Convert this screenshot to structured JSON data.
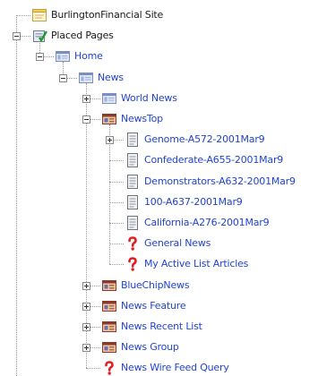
{
  "colors": {
    "link": "#2244cc",
    "dark_text": "#1a1a1a",
    "tree_line": "#9a9a9a",
    "page_folder": "#7a8fc0",
    "news_folder": "#8b3a2a",
    "question_mark": "#e02020",
    "document": "#6c7480"
  },
  "tree": [
    {
      "label": "BurlingtonFinancial Site",
      "icon": "site-icon",
      "depth": 0,
      "expander": "none",
      "style": "dark"
    },
    {
      "label": "Placed Pages",
      "icon": "placed-pages-icon",
      "depth": 0,
      "expander": "minus",
      "style": "dark"
    },
    {
      "label": "Home",
      "icon": "page-folder-icon",
      "depth": 1,
      "expander": "minus",
      "style": "link"
    },
    {
      "label": "News",
      "icon": "page-folder-icon",
      "depth": 2,
      "expander": "minus",
      "style": "link"
    },
    {
      "label": "World News",
      "icon": "page-folder-icon",
      "depth": 3,
      "expander": "plus",
      "style": "link"
    },
    {
      "label": "NewsTop",
      "icon": "news-folder-icon",
      "depth": 3,
      "expander": "minus",
      "style": "link"
    },
    {
      "label": "Genome-A572-2001Mar9",
      "icon": "document-icon",
      "depth": 4,
      "expander": "plus",
      "style": "link"
    },
    {
      "label": "Confederate-A655-2001Mar9",
      "icon": "document-icon",
      "depth": 4,
      "expander": "none",
      "style": "link"
    },
    {
      "label": "Demonstrators-A632-2001Mar9",
      "icon": "document-icon",
      "depth": 4,
      "expander": "none",
      "style": "link"
    },
    {
      "label": "100-A637-2001Mar9",
      "icon": "document-icon",
      "depth": 4,
      "expander": "none",
      "style": "link"
    },
    {
      "label": "California-A276-2001Mar9",
      "icon": "document-icon",
      "depth": 4,
      "expander": "none",
      "style": "link"
    },
    {
      "label": "General News",
      "icon": "question-icon",
      "depth": 4,
      "expander": "none",
      "style": "link"
    },
    {
      "label": "My Active List Articles",
      "icon": "question-icon",
      "depth": 4,
      "expander": "none",
      "style": "link"
    },
    {
      "label": "BlueChipNews",
      "icon": "news-folder-icon",
      "depth": 3,
      "expander": "plus",
      "style": "link"
    },
    {
      "label": "News Feature",
      "icon": "news-folder-icon",
      "depth": 3,
      "expander": "plus",
      "style": "link"
    },
    {
      "label": "News Recent List",
      "icon": "news-folder-icon",
      "depth": 3,
      "expander": "plus",
      "style": "link"
    },
    {
      "label": "News Group",
      "icon": "news-folder-icon",
      "depth": 3,
      "expander": "plus",
      "style": "link"
    },
    {
      "label": "News Wire Feed Query",
      "icon": "question-icon",
      "depth": 3,
      "expander": "none",
      "style": "link"
    }
  ]
}
